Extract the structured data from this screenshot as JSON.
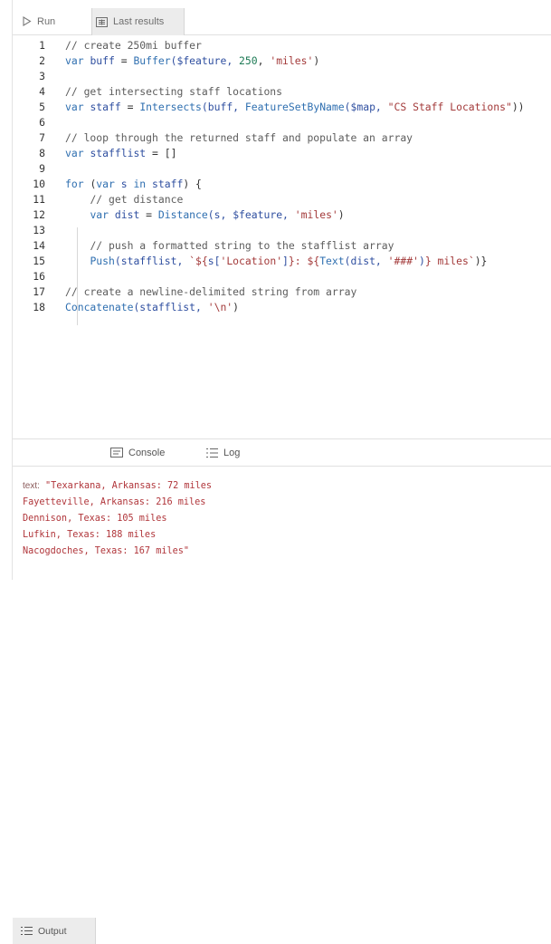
{
  "toolbar": {
    "run_label": "Run",
    "last_results_label": "Last results"
  },
  "editor": {
    "lines": [
      {
        "n": "1",
        "segs": [
          {
            "t": "// create 250mi buffer",
            "c": "com"
          }
        ]
      },
      {
        "n": "2",
        "segs": [
          {
            "t": "var ",
            "c": "kw"
          },
          {
            "t": "buff",
            "c": "var"
          },
          {
            "t": " = ",
            "c": "txt"
          },
          {
            "t": "Buffer",
            "c": "fn"
          },
          {
            "t": "($feature, ",
            "c": "var"
          },
          {
            "t": "250",
            "c": "num"
          },
          {
            "t": ", ",
            "c": "txt"
          },
          {
            "t": "'miles'",
            "c": "str"
          },
          {
            "t": ")",
            "c": "txt"
          }
        ]
      },
      {
        "n": "3",
        "segs": []
      },
      {
        "n": "4",
        "segs": [
          {
            "t": "// get intersecting staff locations",
            "c": "com"
          }
        ]
      },
      {
        "n": "5",
        "segs": [
          {
            "t": "var ",
            "c": "kw"
          },
          {
            "t": "staff",
            "c": "var"
          },
          {
            "t": " = ",
            "c": "txt"
          },
          {
            "t": "Intersects",
            "c": "fn"
          },
          {
            "t": "(buff, ",
            "c": "var"
          },
          {
            "t": "FeatureSetByName",
            "c": "fn"
          },
          {
            "t": "($map, ",
            "c": "var"
          },
          {
            "t": "\"CS Staff Locations\"",
            "c": "str"
          },
          {
            "t": "))",
            "c": "txt"
          }
        ]
      },
      {
        "n": "6",
        "segs": []
      },
      {
        "n": "7",
        "segs": [
          {
            "t": "// loop through the returned staff and populate an array",
            "c": "com"
          }
        ]
      },
      {
        "n": "8",
        "segs": [
          {
            "t": "var ",
            "c": "kw"
          },
          {
            "t": "stafflist",
            "c": "var"
          },
          {
            "t": " = []",
            "c": "txt"
          }
        ]
      },
      {
        "n": "9",
        "segs": []
      },
      {
        "n": "10",
        "segs": [
          {
            "t": "for ",
            "c": "kw"
          },
          {
            "t": "(",
            "c": "txt"
          },
          {
            "t": "var ",
            "c": "kw"
          },
          {
            "t": "s ",
            "c": "var"
          },
          {
            "t": "in ",
            "c": "kw"
          },
          {
            "t": "staff",
            "c": "var"
          },
          {
            "t": ") {",
            "c": "txt"
          }
        ]
      },
      {
        "n": "11",
        "segs": [
          {
            "t": "    ",
            "c": "txt"
          },
          {
            "t": "// get distance",
            "c": "com"
          }
        ]
      },
      {
        "n": "12",
        "segs": [
          {
            "t": "    ",
            "c": "txt"
          },
          {
            "t": "var ",
            "c": "kw"
          },
          {
            "t": "dist",
            "c": "var"
          },
          {
            "t": " = ",
            "c": "txt"
          },
          {
            "t": "Distance",
            "c": "fn"
          },
          {
            "t": "(s, $feature, ",
            "c": "var"
          },
          {
            "t": "'miles'",
            "c": "str"
          },
          {
            "t": ")",
            "c": "txt"
          }
        ]
      },
      {
        "n": "13",
        "segs": []
      },
      {
        "n": "14",
        "segs": [
          {
            "t": "    ",
            "c": "txt"
          },
          {
            "t": "// push a formatted string to the stafflist array",
            "c": "com"
          }
        ]
      },
      {
        "n": "15",
        "segs": [
          {
            "t": "    ",
            "c": "txt"
          },
          {
            "t": "Push",
            "c": "fn"
          },
          {
            "t": "(stafflist, ",
            "c": "var"
          },
          {
            "t": "`${",
            "c": "str"
          },
          {
            "t": "s[",
            "c": "var"
          },
          {
            "t": "'Location'",
            "c": "str"
          },
          {
            "t": "]",
            "c": "var"
          },
          {
            "t": "}: ${",
            "c": "str"
          },
          {
            "t": "Text",
            "c": "fn"
          },
          {
            "t": "(dist, ",
            "c": "var"
          },
          {
            "t": "'###'",
            "c": "str"
          },
          {
            "t": ")",
            "c": "var"
          },
          {
            "t": "} miles`",
            "c": "str"
          },
          {
            "t": ")}",
            "c": "txt"
          }
        ]
      },
      {
        "n": "16",
        "segs": []
      },
      {
        "n": "17",
        "segs": [
          {
            "t": "// create a newline-delimited string from array",
            "c": "com"
          }
        ]
      },
      {
        "n": "18",
        "segs": [
          {
            "t": "Concatenate",
            "c": "fn"
          },
          {
            "t": "(stafflist, ",
            "c": "var"
          },
          {
            "t": "'\\n'",
            "c": "str"
          },
          {
            "t": ")",
            "c": "txt"
          }
        ]
      }
    ]
  },
  "bottom_tabs": {
    "output_label": "Output",
    "console_label": "Console",
    "log_label": "Log"
  },
  "output": {
    "label": "text:",
    "lines": [
      "\"Texarkana, Arkansas: 72 miles",
      "Fayetteville, Arkansas: 216 miles",
      "Dennison, Texas: 105 miles",
      "Lufkin, Texas: 188 miles",
      "Nacogdoches, Texas: 167 miles\""
    ]
  }
}
